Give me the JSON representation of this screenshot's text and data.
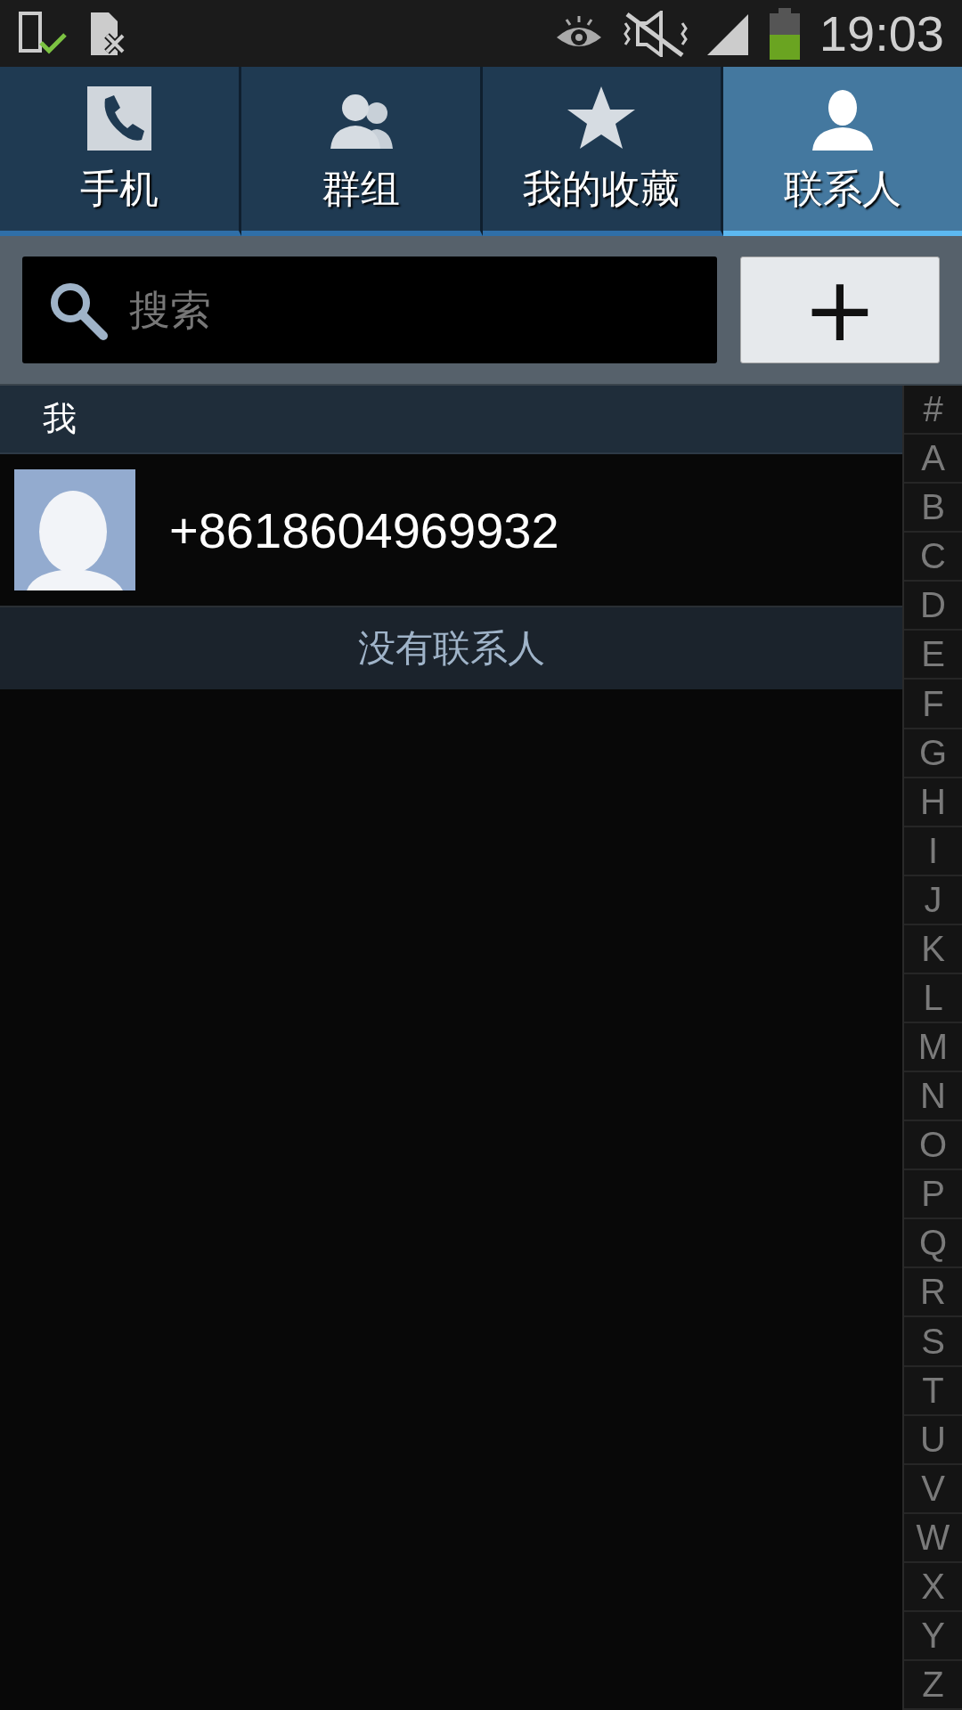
{
  "status_bar": {
    "time": "19:03"
  },
  "tabs": [
    {
      "label": "手机",
      "kind": "phone",
      "selected": false
    },
    {
      "label": "群组",
      "kind": "group",
      "selected": false
    },
    {
      "label": "我的收藏",
      "kind": "star",
      "selected": false
    },
    {
      "label": "联系人",
      "kind": "person",
      "selected": true
    }
  ],
  "search": {
    "placeholder": "搜索"
  },
  "add_button": {
    "label": "+"
  },
  "sections": [
    {
      "header": "我",
      "contacts": [
        {
          "name": "+8618604969932"
        }
      ]
    }
  ],
  "empty_message": "没有联系人",
  "index": [
    "#",
    "A",
    "B",
    "C",
    "D",
    "E",
    "F",
    "G",
    "H",
    "I",
    "J",
    "K",
    "L",
    "M",
    "N",
    "O",
    "P",
    "Q",
    "R",
    "S",
    "T",
    "U",
    "V",
    "W",
    "X",
    "Y",
    "Z"
  ]
}
